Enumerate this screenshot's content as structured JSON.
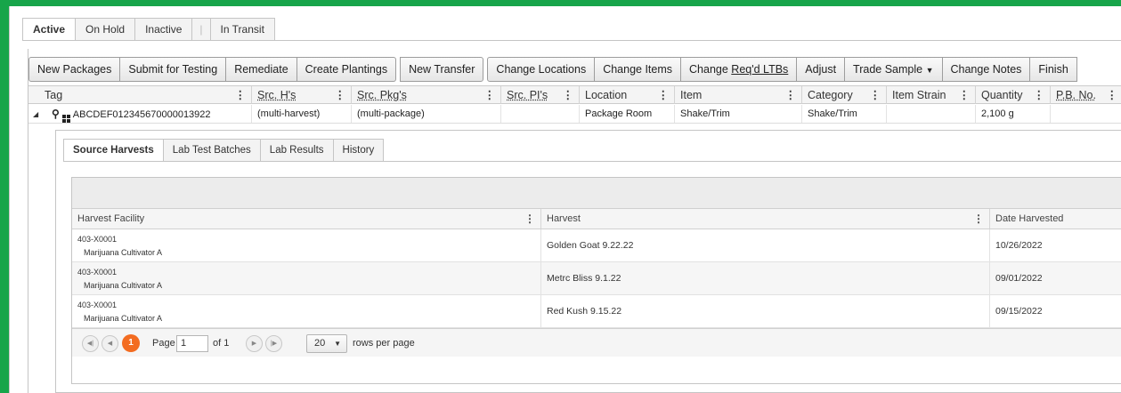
{
  "status_tabs": {
    "active": "Active",
    "on_hold": "On Hold",
    "inactive": "Inactive",
    "separator": "|",
    "in_transit": "In Transit"
  },
  "toolbar": {
    "new_packages": "New Packages",
    "submit_for_testing": "Submit for Testing",
    "remediate": "Remediate",
    "create_plantings": "Create Plantings",
    "new_transfer": "New Transfer",
    "change_locations": "Change Locations",
    "change_items": "Change Items",
    "change_reqd_ltbs_prefix": "Change ",
    "change_reqd_ltbs_underlined": "Req'd LTBs",
    "adjust": "Adjust",
    "trade_sample": "Trade Sample",
    "change_notes": "Change Notes",
    "finish": "Finish"
  },
  "columns": {
    "tag": "Tag",
    "src_hs": "Src. H's",
    "src_pkgs": "Src. Pkg's",
    "src_pis": "Src. PI's",
    "location": "Location",
    "item": "Item",
    "category": "Category",
    "item_strain": "Item Strain",
    "quantity": "Quantity",
    "pb_no": "P.B. No."
  },
  "row": {
    "tag": "ABCDEF012345670000013922",
    "src_hs": "(multi-harvest)",
    "src_pkgs": "(multi-package)",
    "src_pis": "",
    "location": "Package Room",
    "item": "Shake/Trim",
    "category": "Shake/Trim",
    "item_strain": "",
    "quantity": "2,100 g",
    "pb_no": ""
  },
  "detail_tabs": {
    "source_harvests": "Source Harvests",
    "lab_test_batches": "Lab Test Batches",
    "lab_results": "Lab Results",
    "history": "History"
  },
  "sub_columns": {
    "harvest_facility": "Harvest Facility",
    "harvest": "Harvest",
    "date_harvested": "Date Harvested"
  },
  "harvests": [
    {
      "facility_id": "403-X0001",
      "facility_name": "Marijuana Cultivator A",
      "harvest": "Golden Goat 9.22.22",
      "date": "10/26/2022"
    },
    {
      "facility_id": "403-X0001",
      "facility_name": "Marijuana Cultivator A",
      "harvest": "Metrc Bliss 9.1.22",
      "date": "09/01/2022"
    },
    {
      "facility_id": "403-X0001",
      "facility_name": "Marijuana Cultivator A",
      "harvest": "Red Kush 9.15.22",
      "date": "09/15/2022"
    }
  ],
  "pager": {
    "current_page": "1",
    "page_label": "Page",
    "page_value": "1",
    "of_label": "of 1",
    "rows_per_page_value": "20",
    "rows_per_page_label": "rows per page"
  },
  "icons": {
    "expander": "collapse-triangle-icon",
    "search": "magnifier-icon",
    "qr": "qr-code-icon"
  },
  "colors": {
    "frame_green": "#17a54a",
    "pager_active": "#f36c21"
  }
}
